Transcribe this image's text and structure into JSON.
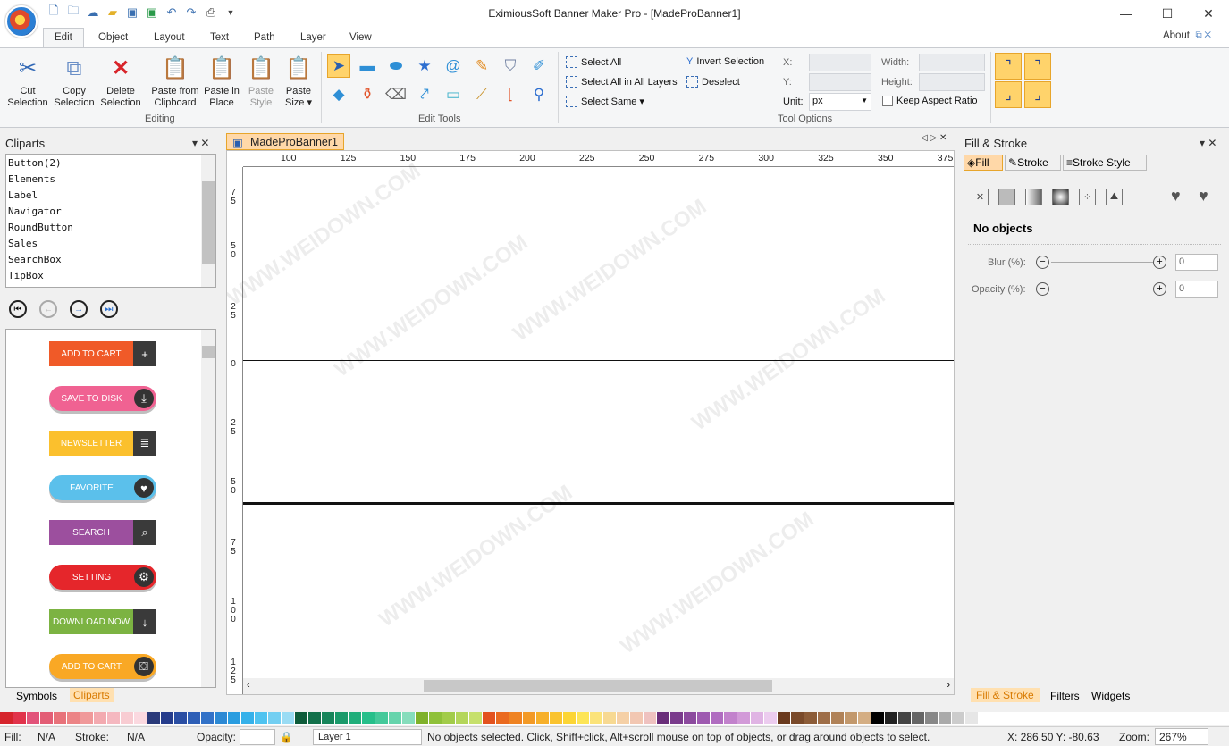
{
  "window": {
    "title": "EximiousSoft Banner Maker Pro - [MadeProBanner1]",
    "minimize": "—",
    "maximize": "☐",
    "close": "✕"
  },
  "qat_icons": [
    "new-icon",
    "open-icon",
    "cloud-icon",
    "folder-icon",
    "save-icon",
    "save-as-icon",
    "undo-icon",
    "redo-icon",
    "print-icon",
    "dropdown-icon"
  ],
  "menu": {
    "tabs": [
      "Edit",
      "Object",
      "Layout",
      "Text",
      "Path",
      "Layer",
      "View"
    ],
    "active": "Edit",
    "about": "About"
  },
  "ribbon": {
    "editing": {
      "label": "Editing",
      "cut": "Cut\nSelection",
      "cut_1": "Cut",
      "cut_2": "Selection",
      "copy_1": "Copy",
      "copy_2": "Selection",
      "delete_1": "Delete",
      "delete_2": "Selection",
      "paste_clip_1": "Paste from",
      "paste_clip_2": "Clipboard",
      "paste_place_1": "Paste in",
      "paste_place_2": "Place",
      "paste_style_1": "Paste",
      "paste_style_2": "Style",
      "paste_size_1": "Paste",
      "paste_size_2": "Size ▾"
    },
    "edit_tools": {
      "label": "Edit Tools"
    },
    "selection": {
      "select_all": "Select All",
      "select_all_layers": "Select All in All Layers",
      "select_same": "Select Same ▾",
      "invert": "Invert Selection",
      "deselect": "Deselect"
    },
    "tool_options": {
      "label": "Tool Options",
      "x": "X:",
      "y": "Y:",
      "unit_label": "Unit:",
      "unit_value": "px",
      "width": "Width:",
      "height": "Height:",
      "keep_aspect": "Keep Aspect Ratio"
    }
  },
  "cliparts_panel": {
    "title": "Cliparts",
    "items": [
      "Button(2)",
      "Elements",
      "Label",
      "Navigator",
      "RoundButton",
      "Sales",
      "SearchBox",
      "TipBox"
    ],
    "gallery": [
      {
        "label": "ADD TO CART",
        "color": "#f05a28",
        "style": "rect",
        "icon": "+"
      },
      {
        "label": "SAVE TO DISK",
        "color": "#f06292",
        "style": "pill",
        "icon": "⤓"
      },
      {
        "label": "NEWSLETTER",
        "color": "#fbc02d",
        "style": "rect",
        "icon": "≣"
      },
      {
        "label": "FAVORITE",
        "color": "#5bc0eb",
        "style": "pill",
        "icon": "♥"
      },
      {
        "label": "SEARCH",
        "color": "#9c4f9e",
        "style": "rect",
        "icon": "⌕"
      },
      {
        "label": "SETTING",
        "color": "#e5262b",
        "style": "pill",
        "icon": "⚙"
      },
      {
        "label": "DOWNLOAD NOW",
        "color": "#7cb342",
        "style": "rect",
        "icon": "↓"
      },
      {
        "label": "ADD TO CART",
        "color": "#f9a825",
        "style": "pill",
        "icon": "⛋"
      }
    ],
    "tabs": [
      "Symbols",
      "Cliparts"
    ]
  },
  "document": {
    "tab": "MadeProBanner1",
    "ruler_h": [
      "100",
      "125",
      "150",
      "175",
      "200",
      "225",
      "250",
      "275",
      "300",
      "325",
      "350",
      "375"
    ],
    "ruler_v": [
      "7\n5",
      "5\n0",
      "2\n5",
      "0",
      "2\n5",
      "5\n0",
      "7\n5",
      "1\n0\n0",
      "1\n2\n5"
    ]
  },
  "fill_stroke_panel": {
    "title": "Fill & Stroke",
    "tabs": [
      "Fill",
      "Stroke",
      "Stroke Style"
    ],
    "no_objects": "No objects",
    "blur_label": "Blur (%):",
    "blur_value": "0",
    "opacity_label": "Opacity (%):",
    "opacity_value": "0",
    "bottom_tabs": [
      "Fill & Stroke",
      "Filters",
      "Widgets"
    ]
  },
  "palette": [
    "#d6242c",
    "#e1334b",
    "#e2537a",
    "#e35d75",
    "#e8727a",
    "#ec8486",
    "#f0999a",
    "#f3aab0",
    "#f5b8c0",
    "#f8ccd2",
    "#fbd9e0",
    "#2a3a7a",
    "#253c8c",
    "#2a4ea3",
    "#2e5fb7",
    "#3272c8",
    "#2c89d4",
    "#2a9de0",
    "#35b1ea",
    "#4fc3f0",
    "#73cff2",
    "#9adcf4",
    "#0e5c3a",
    "#12704a",
    "#17855a",
    "#1a9a6a",
    "#20ae7a",
    "#26bf8a",
    "#44c99a",
    "#66d4ac",
    "#86ddbc",
    "#7fb12a",
    "#8fc13a",
    "#a2cc4a",
    "#b4d65a",
    "#c6e06c",
    "#e3521e",
    "#ea6a1f",
    "#ef8322",
    "#f39a26",
    "#f7b02a",
    "#fac32f",
    "#fcd535",
    "#fde557",
    "#fbe37a",
    "#f7d992",
    "#f5d0a6",
    "#f2c7b2",
    "#efc2c0",
    "#6a2e7a",
    "#7a3b8c",
    "#8c4a9e",
    "#9e5ab0",
    "#b06cc0",
    "#c282cc",
    "#d29ad8",
    "#e0b4e4",
    "#ecccef",
    "#6a3a1e",
    "#7a4a2a",
    "#8c5c38",
    "#9e6e48",
    "#b08258",
    "#c2986c",
    "#d4ae84",
    "#000000",
    "#222222",
    "#444444",
    "#666666",
    "#888888",
    "#aaaaaa",
    "#cccccc",
    "#e6e6e6"
  ],
  "status": {
    "fill_label": "Fill:",
    "fill_value": "N/A",
    "stroke_label": "Stroke:",
    "stroke_value": "N/A",
    "opacity_label": "Opacity:",
    "layer": "Layer 1",
    "message": "No objects selected. Click, Shift+click, Alt+scroll mouse on top of objects, or drag around objects to select.",
    "coords": "X: 286.50 Y: -80.63",
    "zoom_label": "Zoom:",
    "zoom_value": "267%"
  },
  "watermark": "WWW.WEIDOWN.COM"
}
